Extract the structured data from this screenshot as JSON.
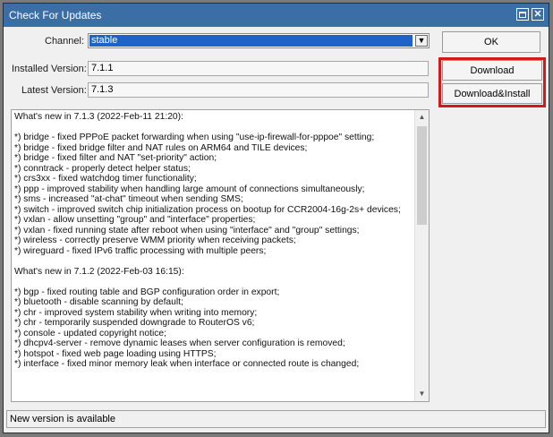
{
  "window": {
    "title": "Check For Updates"
  },
  "form": {
    "channel_label": "Channel:",
    "channel_value": "stable",
    "installed_label": "Installed Version:",
    "installed_value": "7.1.1",
    "latest_label": "Latest Version:",
    "latest_value": "7.1.3"
  },
  "buttons": {
    "ok": "OK",
    "download": "Download",
    "download_install": "Download&Install"
  },
  "changelog": "What's new in 7.1.3 (2022-Feb-11 21:20):\n\n*) bridge - fixed PPPoE packet forwarding when using \"use-ip-firewall-for-pppoe\" setting;\n*) bridge - fixed bridge filter and NAT rules on ARM64 and TILE devices;\n*) bridge - fixed filter and NAT \"set-priority\" action;\n*) conntrack - properly detect helper status;\n*) crs3xx - fixed watchdog timer functionality;\n*) ppp - improved stability when handling large amount of connections simultaneously;\n*) sms - increased \"at-chat\" timeout when sending SMS;\n*) switch - improved switch chip initialization process on bootup for CCR2004-16g-2s+ devices;\n*) vxlan - allow unsetting \"group\" and \"interface\" properties;\n*) vxlan - fixed running state after reboot when using \"interface\" and \"group\" settings;\n*) wireless - correctly preserve WMM priority when receiving packets;\n*) wireguard - fixed IPv6 traffic processing with multiple peers;\n\nWhat's new in 7.1.2 (2022-Feb-03 16:15):\n\n*) bgp - fixed routing table and BGP configuration order in export;\n*) bluetooth - disable scanning by default;\n*) chr - improved system stability when writing into memory;\n*) chr - temporarily suspended downgrade to RouterOS v6;\n*) console - updated copyright notice;\n*) dhcpv4-server - remove dynamic leases when server configuration is removed;\n*) hotspot - fixed web page loading using HTTPS;\n*) interface - fixed minor memory leak when interface or connected route is changed;",
  "status": {
    "text": "New version is available"
  },
  "colors": {
    "titlebar": "#3a6ea5",
    "selection": "#1e64c8",
    "highlight_box": "#d11a1a"
  }
}
